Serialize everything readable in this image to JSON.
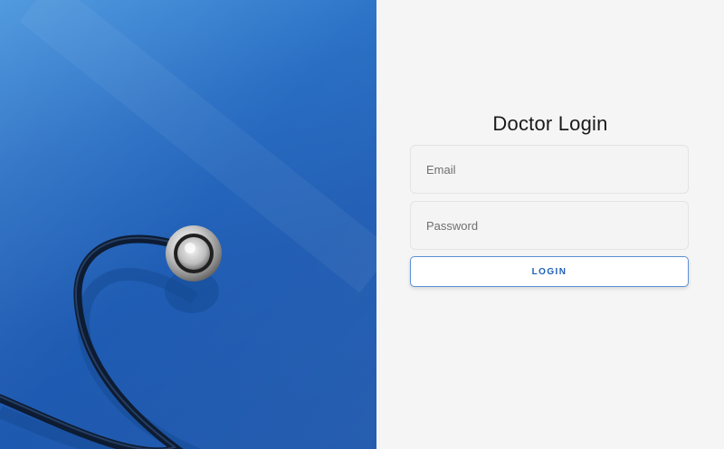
{
  "hero": {
    "image_subject": "stethoscope",
    "background_color": "#1f5cb3",
    "accent_color": "#3f8fdb"
  },
  "login_form": {
    "title": "Doctor Login",
    "email_placeholder": "Email",
    "email_value": "",
    "password_placeholder": "Password",
    "password_value": "",
    "login_label": "LOGIN",
    "button_color": "#1f5fb8"
  }
}
